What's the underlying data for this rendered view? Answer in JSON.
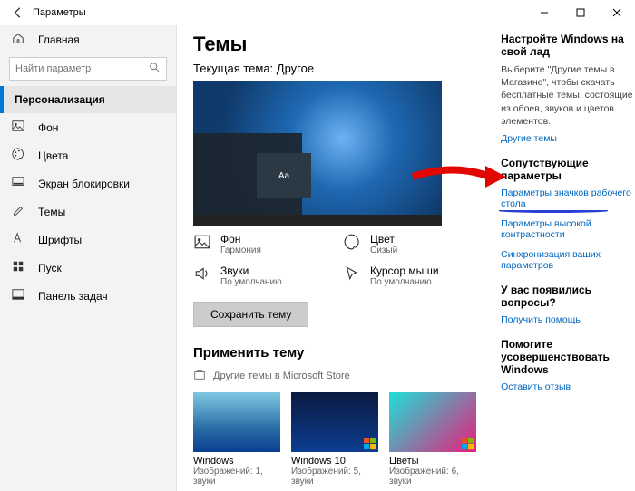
{
  "window": {
    "app_title": "Параметры"
  },
  "sidebar": {
    "home": "Главная",
    "search_placeholder": "Найти параметр",
    "category": "Персонализация",
    "items": [
      {
        "icon": "picture-icon",
        "label": "Фон"
      },
      {
        "icon": "palette-icon",
        "label": "Цвета"
      },
      {
        "icon": "lockscreen-icon",
        "label": "Экран блокировки"
      },
      {
        "icon": "themes-icon",
        "label": "Темы"
      },
      {
        "icon": "fonts-icon",
        "label": "Шрифты"
      },
      {
        "icon": "start-icon",
        "label": "Пуск"
      },
      {
        "icon": "taskbar-icon",
        "label": "Панель задач"
      }
    ]
  },
  "main": {
    "title": "Темы",
    "current_theme_label": "Текущая тема: Другое",
    "preview_sample_text": "Aa",
    "cells": {
      "background": {
        "title": "Фон",
        "value": "Гармония"
      },
      "color": {
        "title": "Цвет",
        "value": "Сизый"
      },
      "sounds": {
        "title": "Звуки",
        "value": "По умолчанию"
      },
      "cursor": {
        "title": "Курсор мыши",
        "value": "По умолчанию"
      }
    },
    "save_button": "Сохранить тему",
    "apply_section": "Применить тему",
    "store_link": "Другие темы в Microsoft Store",
    "themes": [
      {
        "name": "Windows",
        "sub": "Изображений: 1, звуки"
      },
      {
        "name": "Windows 10",
        "sub": "Изображений: 5, звуки"
      },
      {
        "name": "Цветы",
        "sub": "Изображений: 6, звуки"
      }
    ]
  },
  "right": {
    "customize_heading": "Настройте Windows на свой лад",
    "customize_body": "Выберите \"Другие темы в Магазине\", чтобы скачать бесплатные темы, состоящие из обоев, звуков и цветов элементов.",
    "customize_link": "Другие темы",
    "related_heading": "Сопутствующие параметры",
    "related_link_icons": "Параметры значков рабочего стола",
    "related_link_contrast": "Параметры высокой контрастности",
    "related_link_sync": "Синхронизация ваших параметров",
    "questions_heading": "У вас появились вопросы?",
    "questions_link": "Получить помощь",
    "improve_heading": "Помогите усовершенствовать Windows",
    "improve_link": "Оставить отзыв"
  }
}
